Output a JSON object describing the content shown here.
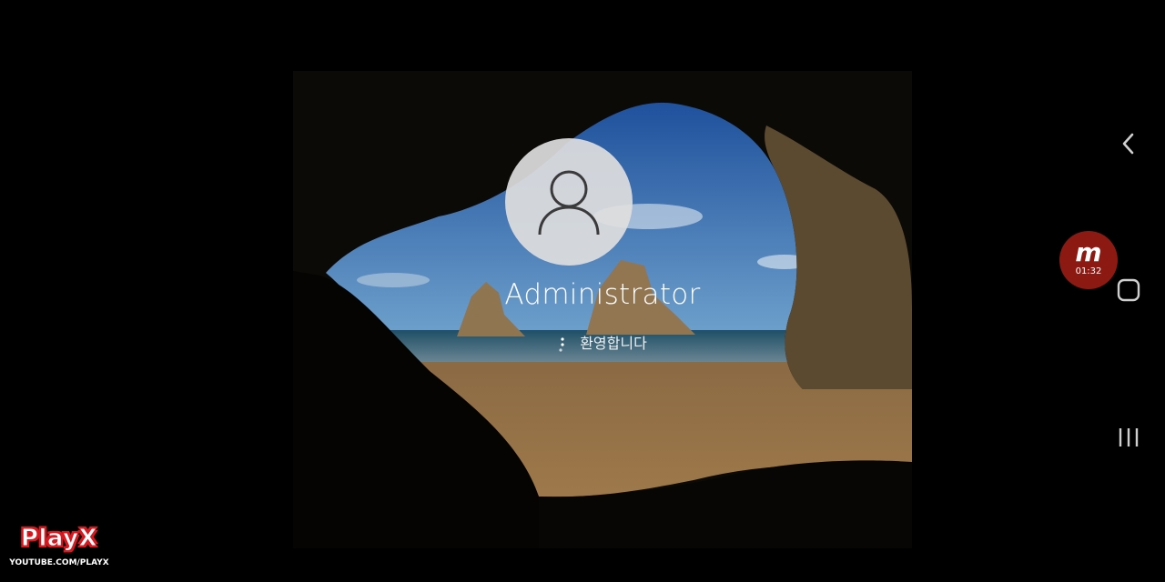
{
  "lock_screen": {
    "username": "Administrator",
    "status_text": "환영합니다"
  },
  "recorder": {
    "logo": "m",
    "timer": "01:32"
  },
  "nav_bar": {
    "back_icon": "chevron-left-icon",
    "home_icon": "rounded-square-icon",
    "recents_icon": "three-bars-icon"
  },
  "watermark": {
    "name": "PlayX",
    "url": "YOUTUBE.COM/PLAYX"
  },
  "colors": {
    "sky": "#2f6fb6",
    "sea": "#2e5f7a",
    "sand": "#9a7648",
    "rock": "#6e5a3c",
    "recorder_red": "#8c1a12",
    "playx_red": "#d71920"
  }
}
